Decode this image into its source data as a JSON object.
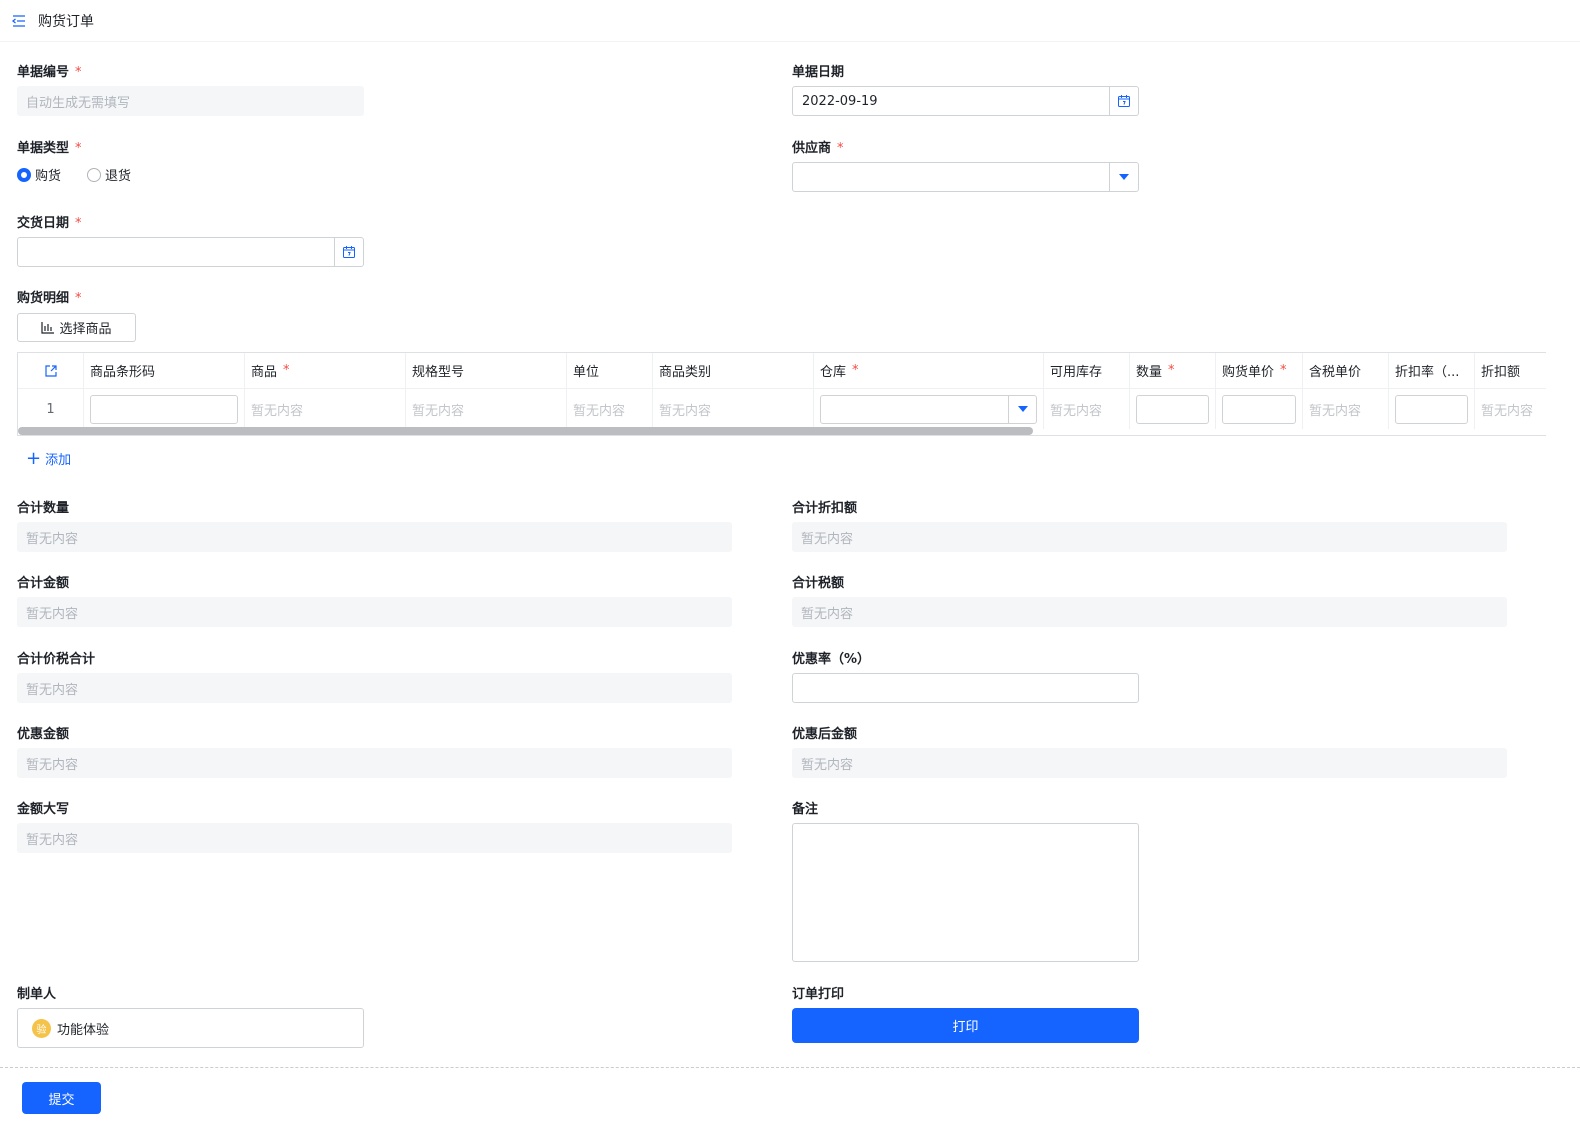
{
  "header": {
    "title": "购货订单",
    "icon": "menu-fold-icon"
  },
  "fields": {
    "doc_no": {
      "label": "单据编号",
      "placeholder": "自动生成无需填写"
    },
    "doc_date": {
      "label": "单据日期",
      "value": "2022-09-19"
    },
    "doc_type": {
      "label": "单据类型",
      "options": [
        "购货",
        "退货"
      ],
      "selected": "购货"
    },
    "supplier": {
      "label": "供应商",
      "value": ""
    },
    "delivery_date": {
      "label": "交货日期",
      "value": ""
    },
    "detail": {
      "label": "购货明细",
      "select_button": "选择商品",
      "add_link": "添加"
    }
  },
  "table": {
    "columns": [
      "商品条形码",
      "商品",
      "规格型号",
      "单位",
      "商品类别",
      "仓库",
      "可用库存",
      "数量",
      "购货单价",
      "含税单价",
      "折扣率（...",
      "折扣额"
    ],
    "row": {
      "index": "1",
      "empty": "暂无内容"
    }
  },
  "summary": {
    "total_qty": {
      "label": "合计数量",
      "value": "暂无内容"
    },
    "total_discount": {
      "label": "合计折扣额",
      "value": "暂无内容"
    },
    "total_amount": {
      "label": "合计金额",
      "value": "暂无内容"
    },
    "total_tax": {
      "label": "合计税额",
      "value": "暂无内容"
    },
    "total_with_tax": {
      "label": "合计价税合计",
      "value": "暂无内容"
    },
    "discount_rate": {
      "label": "优惠率（%）",
      "value": ""
    },
    "discount_amount": {
      "label": "优惠金额",
      "value": "暂无内容"
    },
    "after_discount": {
      "label": "优惠后金额",
      "value": "暂无内容"
    },
    "amount_in_words": {
      "label": "金额大写",
      "value": "暂无内容"
    },
    "remark": {
      "label": "备注",
      "value": ""
    }
  },
  "maker": {
    "label": "制单人",
    "avatar_text": "验",
    "name": "功能体验"
  },
  "print": {
    "label": "订单打印",
    "button": "打印"
  },
  "submit": {
    "button": "提交"
  },
  "colors": {
    "primary": "#1664ff",
    "required": "#f54a45",
    "avatar": "#f6c34a"
  }
}
